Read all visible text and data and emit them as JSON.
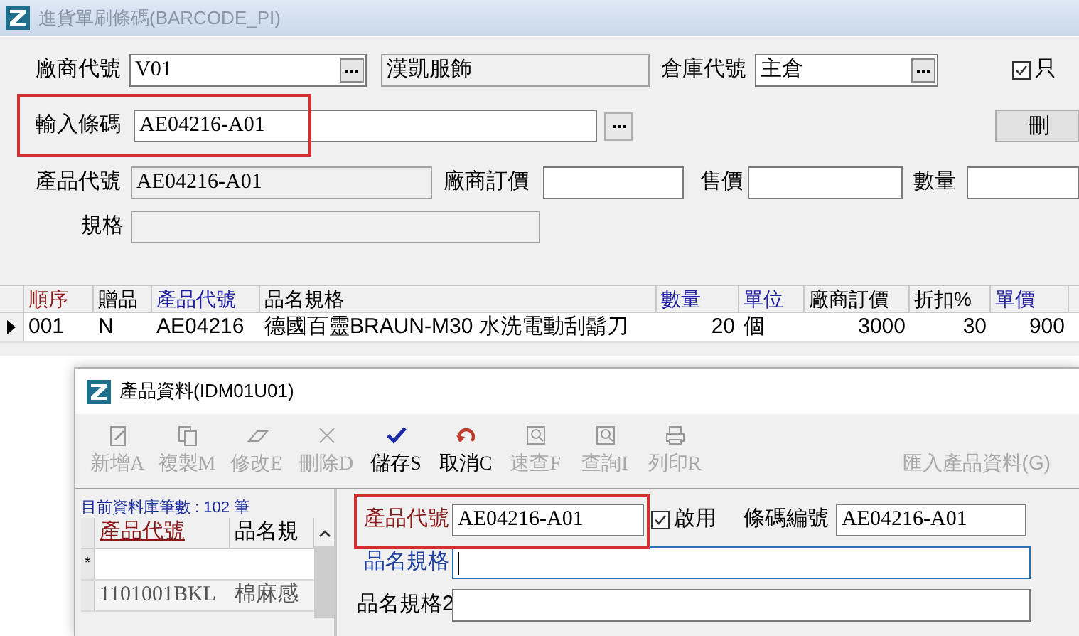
{
  "main_window": {
    "title": "進貨單刷條碼(BARCODE_PI)",
    "vendor": {
      "label": "廠商代號",
      "value": "V01",
      "name": "漢凱服飾"
    },
    "warehouse": {
      "label": "倉庫代號",
      "value": "主倉"
    },
    "option": {
      "label": "只",
      "checked": true
    },
    "barcode": {
      "label": "輸入條碼",
      "value": "AE04216-A01",
      "highlighted": true
    },
    "delete_button": "刪",
    "product_code": {
      "label": "產品代號",
      "value": "AE04216-A01",
      "disabled": true
    },
    "vendor_price": {
      "label": "廠商訂價"
    },
    "price": {
      "label": "售價"
    },
    "quantity": {
      "label": "數量"
    },
    "spec": {
      "label": "規格",
      "disabled": true
    },
    "table": {
      "columns": [
        {
          "label": "順序",
          "color": "#8b1a1a"
        },
        {
          "label": "贈品",
          "color": "#000000"
        },
        {
          "label": "產品代號",
          "color": "#2020a0"
        },
        {
          "label": "品名規格",
          "color": "#000000"
        },
        {
          "label": "數量",
          "color": "#2020a0"
        },
        {
          "label": "單位",
          "color": "#2020a0"
        },
        {
          "label": "廠商訂價",
          "color": "#000000"
        },
        {
          "label": "折扣%",
          "color": "#000000"
        },
        {
          "label": "單價",
          "color": "#2020a0"
        }
      ],
      "rows": [
        {
          "current": true,
          "cells": [
            "001",
            "N",
            "AE04216",
            "德國百靈BRAUN-M30 水洗電動刮鬍刀",
            "20",
            "個",
            "3000",
            "30",
            "900"
          ]
        }
      ]
    }
  },
  "product_window": {
    "title": "產品資料(IDM01U01)",
    "toolbar": [
      {
        "label": "新增A",
        "kind": "new",
        "disabled": true
      },
      {
        "label": "複製M",
        "kind": "copy",
        "disabled": true
      },
      {
        "label": "修改E",
        "kind": "edit",
        "disabled": true
      },
      {
        "label": "刪除D",
        "kind": "delete",
        "disabled": true
      },
      {
        "label": "儲存S",
        "kind": "save",
        "disabled": false
      },
      {
        "label": "取消C",
        "kind": "cancel",
        "disabled": false
      },
      {
        "label": "速查F",
        "kind": "find",
        "disabled": true
      },
      {
        "label": "查詢I",
        "kind": "find",
        "disabled": true
      },
      {
        "label": "列印R",
        "kind": "print",
        "disabled": true
      }
    ],
    "import_button": {
      "label": "匯入產品資料(G)",
      "disabled": true
    },
    "list": {
      "count_text": "目前資料庫筆數 : 102 筆",
      "columns": [
        {
          "label": "產品代號"
        },
        {
          "label": "品名規"
        }
      ],
      "rows": [
        {
          "marker": "*",
          "cells": []
        },
        {
          "cells": [
            "1101001BKL",
            "棉麻感"
          ]
        }
      ]
    },
    "form": {
      "product_code": {
        "label": "產品代號",
        "color": "#8b1a1a",
        "value": "AE04216-A01",
        "highlighted": true
      },
      "enabled": {
        "label": "啟用",
        "checked": true
      },
      "barcode_no": {
        "label": "條碼編號",
        "color": "#000000",
        "value": "AE04216-A01"
      },
      "name": {
        "label": "品名規格",
        "color": "#1c3fa0",
        "focused": true
      },
      "name2": {
        "label": "品名規格2",
        "color": "#000000",
        "focused": false
      }
    }
  }
}
